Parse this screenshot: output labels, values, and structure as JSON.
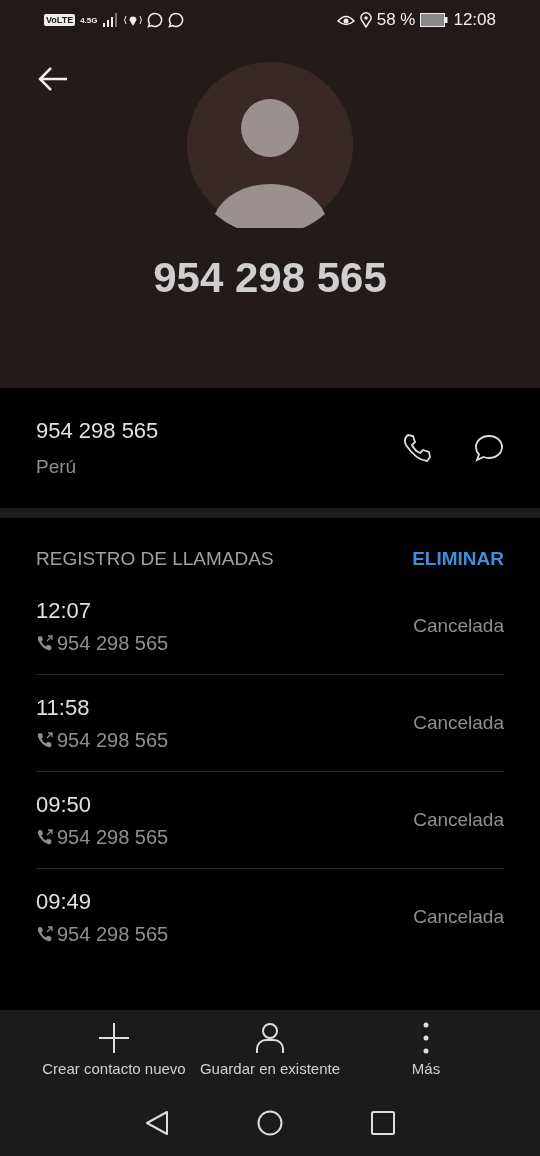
{
  "status_bar": {
    "volte": "VoLTE",
    "network": "4.5G",
    "battery": "58 %",
    "time": "12:08"
  },
  "header": {
    "title": "954 298 565"
  },
  "contact": {
    "number": "954 298 565",
    "country": "Perú"
  },
  "call_log": {
    "title": "REGISTRO DE LLAMADAS",
    "action": "ELIMINAR",
    "rows": [
      {
        "time": "12:07",
        "number": "954 298 565",
        "status": "Cancelada"
      },
      {
        "time": "11:58",
        "number": "954 298 565",
        "status": "Cancelada"
      },
      {
        "time": "09:50",
        "number": "954 298 565",
        "status": "Cancelada"
      },
      {
        "time": "09:49",
        "number": "954 298 565",
        "status": "Cancelada"
      }
    ]
  },
  "actions": [
    {
      "kind": "add",
      "label": "Crear contacto nuevo"
    },
    {
      "kind": "person",
      "label": "Guardar en existente"
    },
    {
      "kind": "more",
      "label": "Más"
    }
  ]
}
